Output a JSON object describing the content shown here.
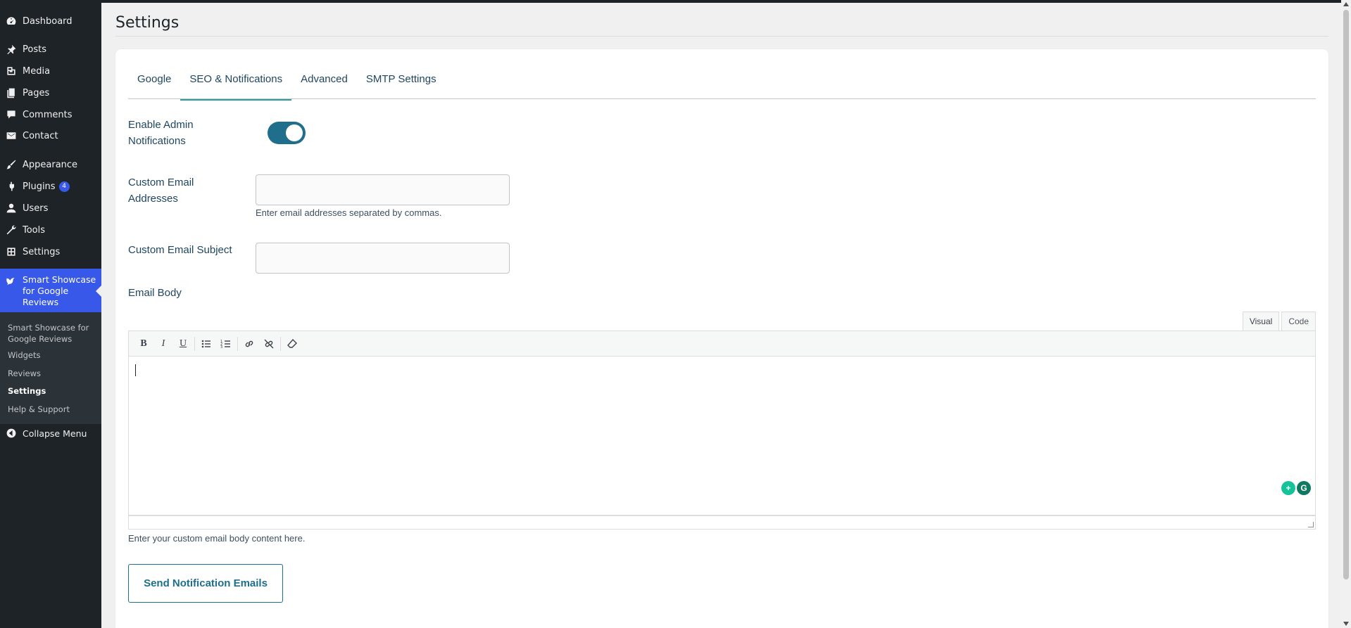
{
  "sidebar": {
    "items": [
      {
        "label": "Dashboard",
        "icon": "dashboard-icon"
      },
      {
        "label": "Posts",
        "icon": "pin-icon"
      },
      {
        "label": "Media",
        "icon": "media-icon"
      },
      {
        "label": "Pages",
        "icon": "pages-icon"
      },
      {
        "label": "Comments",
        "icon": "comment-icon"
      },
      {
        "label": "Contact",
        "icon": "mail-icon"
      },
      {
        "label": "Appearance",
        "icon": "brush-icon"
      },
      {
        "label": "Plugins",
        "icon": "plugin-icon",
        "badge": "4"
      },
      {
        "label": "Users",
        "icon": "user-icon"
      },
      {
        "label": "Tools",
        "icon": "wrench-icon"
      },
      {
        "label": "Settings",
        "icon": "settings-icon"
      }
    ],
    "current": {
      "label": "Smart Showcase for Google Reviews",
      "icon": "bird-icon"
    },
    "submenu": [
      {
        "label": "Smart Showcase for Google Reviews",
        "active": false
      },
      {
        "label": "Widgets",
        "active": false
      },
      {
        "label": "Reviews",
        "active": false
      },
      {
        "label": "Settings",
        "active": true
      },
      {
        "label": "Help & Support",
        "active": false
      }
    ],
    "collapse_label": "Collapse Menu"
  },
  "page": {
    "title": "Settings"
  },
  "tabs": [
    {
      "label": "Google",
      "active": false
    },
    {
      "label": "SEO & Notifications",
      "active": true
    },
    {
      "label": "Advanced",
      "active": false
    },
    {
      "label": "SMTP Settings",
      "active": false
    }
  ],
  "form": {
    "admin_notifications_label": "Enable Admin Notifications",
    "admin_notifications_enabled": true,
    "emails_label": "Custom Email Addresses",
    "emails_value": "",
    "emails_help": "Enter email addresses separated by commas.",
    "subject_label": "Custom Email Subject",
    "subject_value": "",
    "body_label": "Email Body",
    "body_help": "Enter your custom email body content here.",
    "send_button": "Send Notification Emails"
  },
  "editor": {
    "mode_tabs": [
      "Visual",
      "Code"
    ],
    "active_mode": "Visual",
    "toolbar": [
      {
        "label": "B",
        "name": "bold-button"
      },
      {
        "label": "I",
        "name": "italic-button"
      },
      {
        "label": "U",
        "name": "underline-button"
      }
    ],
    "content": ""
  },
  "colors": {
    "accent": "#3858e9",
    "primary": "#1f6e8c",
    "tab_underline": "#2a9d9f"
  }
}
